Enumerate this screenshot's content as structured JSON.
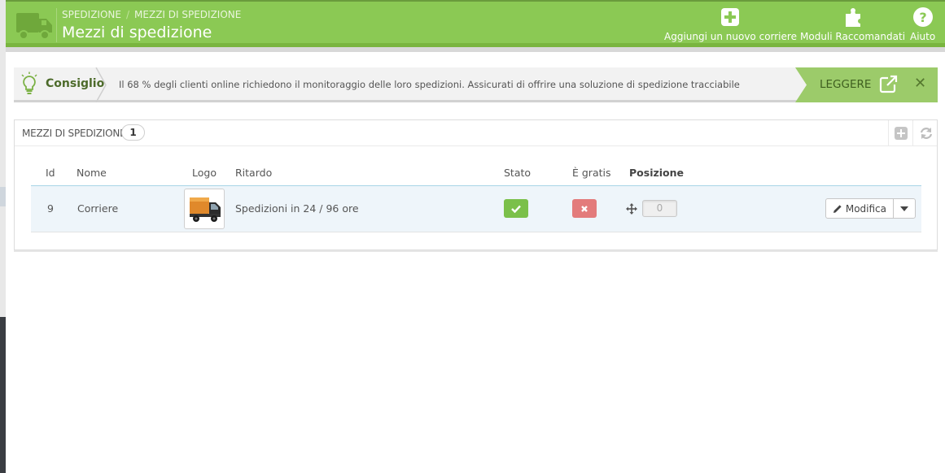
{
  "header": {
    "breadcrumb": [
      "SPEDIZIONE",
      "MEZZI DI SPEDIZIONE"
    ],
    "breadcrumb_separator": "/",
    "title": "Mezzi di spedizione",
    "toolbar": [
      {
        "label": "Aggiungi un nuovo corriere",
        "icon": "plus-square-icon"
      },
      {
        "label": "Moduli Raccomandati",
        "icon": "puzzle-icon"
      },
      {
        "label": "Aiuto",
        "icon": "help-circle-icon"
      }
    ],
    "colors": {
      "bar": "#8bc954",
      "bar_dark": "#79b53f"
    }
  },
  "tip": {
    "title": "Consiglio",
    "text": "Il 68 % degli clienti online richiedono il monitoraggio delle loro spedizioni. Assicurati di offrire una soluzione di spedizione tracciabile",
    "cta_label": "LEGGERE",
    "close_label": "✕",
    "icons": [
      "lightbulb-icon",
      "external-link-icon",
      "close-icon"
    ]
  },
  "panel": {
    "title": "MEZZI DI SPEDIZIONE",
    "count": "1",
    "tools": [
      "add-icon",
      "refresh-icon"
    ],
    "columns": {
      "id": "Id",
      "name": "Nome",
      "logo": "Logo",
      "delay": "Ritardo",
      "status": "Stato",
      "free": "È gratis",
      "position": "Posizione"
    },
    "rows": [
      {
        "id": "9",
        "name": "Corriere",
        "logo_icon": "truck-icon",
        "delay": "Spedizioni in 24 / 96 ore",
        "status": "enabled",
        "free": "no",
        "position": "0",
        "edit_label": "Modifica"
      }
    ],
    "colors": {
      "enabled": "#7bc04a",
      "disabled": "#e37b7b"
    }
  }
}
